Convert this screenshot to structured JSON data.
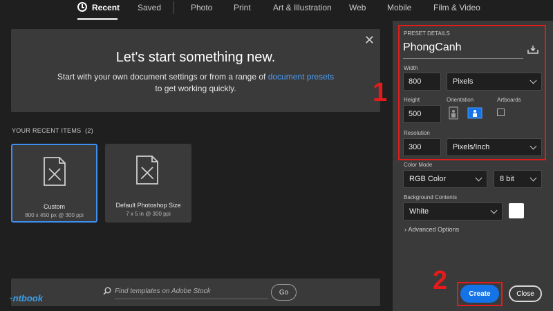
{
  "tabs": [
    {
      "label": "Recent",
      "active": true
    },
    {
      "label": "Saved"
    },
    {
      "label": "Photo"
    },
    {
      "label": "Print"
    },
    {
      "label": "Art & Illustration"
    },
    {
      "label": "Web"
    },
    {
      "label": "Mobile"
    },
    {
      "label": "Film & Video"
    }
  ],
  "hero": {
    "title": "Let's start something new.",
    "subtitle_pre": "Start with your own document settings or from a range of ",
    "subtitle_link": "document presets",
    "subtitle_post": "to get working quickly."
  },
  "recent": {
    "title": "YOUR RECENT ITEMS",
    "count": "(2)",
    "items": [
      {
        "name": "Custom",
        "detail": "800 x 450 px @ 300 ppi",
        "selected": true
      },
      {
        "name": "Default Photoshop Size",
        "detail": "7 x 5 in @ 300 ppi"
      }
    ]
  },
  "search": {
    "placeholder": "Find templates on Adobe Stock",
    "go_label": "Go"
  },
  "logo": {
    "text": "ntbook"
  },
  "preset": {
    "header": "PRESET DETAILS",
    "name": "PhongCanh",
    "width_label": "Width",
    "width_value": "800",
    "width_unit": "Pixels",
    "height_label": "Height",
    "height_value": "500",
    "orientation_label": "Orientation",
    "artboards_label": "Artboards",
    "resolution_label": "Resolution",
    "resolution_value": "300",
    "resolution_unit": "Pixels/Inch",
    "color_mode_label": "Color Mode",
    "color_mode_value": "RGB Color",
    "bit_depth": "8 bit",
    "background_label": "Background Contents",
    "background_value": "White",
    "advanced_label": "Advanced Options"
  },
  "buttons": {
    "create": "Create",
    "close": "Close"
  },
  "annotations": {
    "one": "1",
    "two": "2"
  },
  "colors": {
    "accent": "#1473e6",
    "annotation": "#e31b1b",
    "panel": "#3a3a3a",
    "background": "#1f1f1f"
  }
}
